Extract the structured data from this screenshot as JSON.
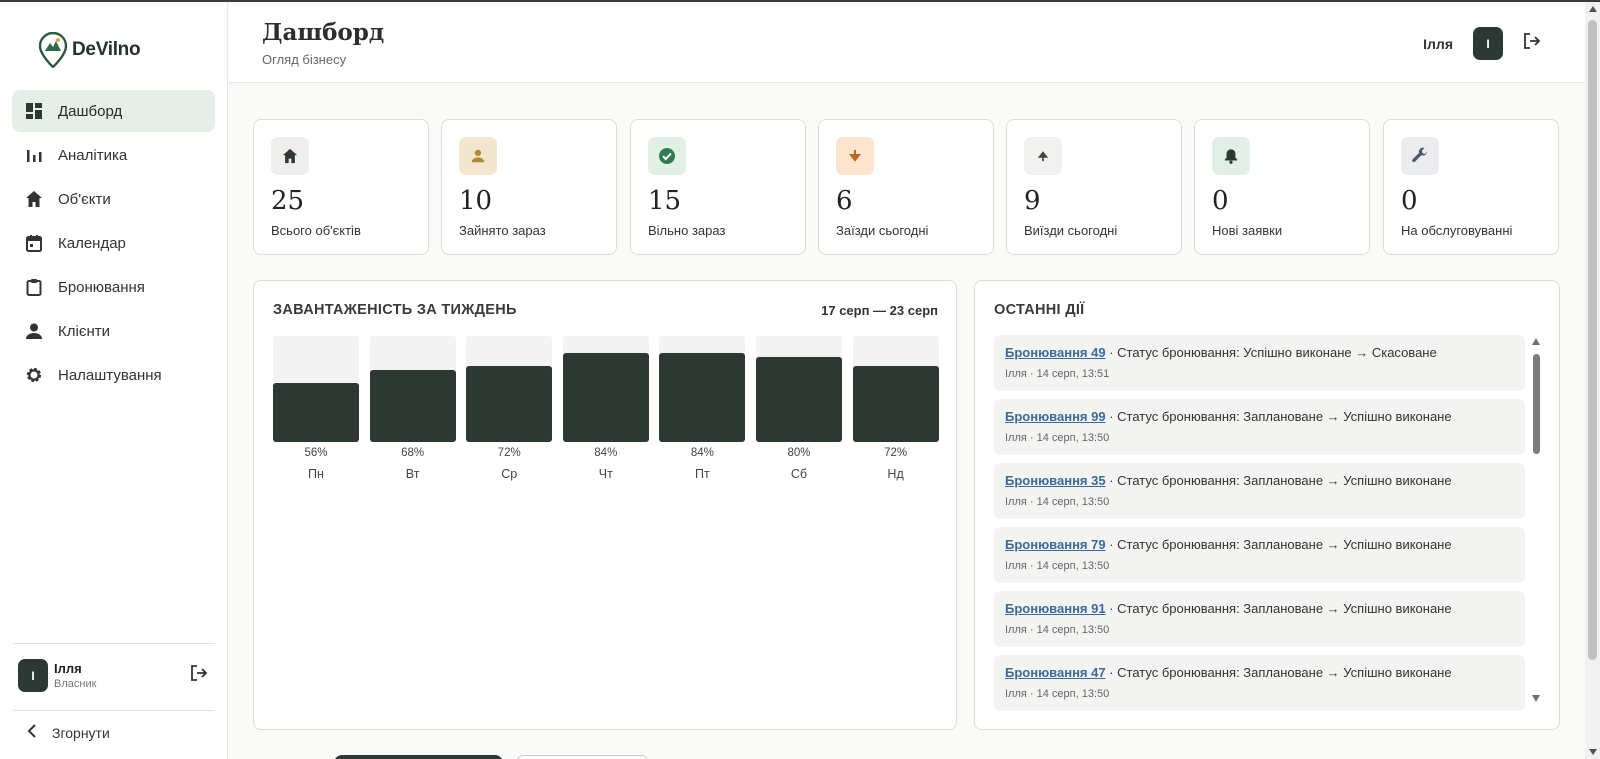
{
  "app": {
    "logo_text": "DeVilno"
  },
  "sidebar": {
    "items": [
      {
        "label": "Дашборд",
        "icon": "dashboard-icon",
        "active": true
      },
      {
        "label": "Аналітика",
        "icon": "analytics-icon",
        "active": false
      },
      {
        "label": "Об'єкти",
        "icon": "home-icon",
        "active": false
      },
      {
        "label": "Календар",
        "icon": "calendar-icon",
        "active": false
      },
      {
        "label": "Бронювання",
        "icon": "clipboard-icon",
        "active": false
      },
      {
        "label": "Клієнти",
        "icon": "person-icon",
        "active": false
      },
      {
        "label": "Налаштування",
        "icon": "gear-icon",
        "active": false
      }
    ],
    "user": {
      "initial": "І",
      "name": "Ілля",
      "role": "Власник"
    },
    "collapse_label": "Згорнути"
  },
  "header": {
    "title": "Дашборд",
    "subtitle": "Огляд бізнесу",
    "user_name": "Ілля",
    "user_initial": "І"
  },
  "stats": [
    {
      "value": "25",
      "label": "Всього об'єктів",
      "icon": "home-icon",
      "color": "#2b3833",
      "bg": "#eeeeed"
    },
    {
      "value": "10",
      "label": "Зайнято зараз",
      "icon": "person-icon",
      "color": "#b08a2e",
      "bg": "#f3e6cf"
    },
    {
      "value": "15",
      "label": "Вільно зараз",
      "icon": "check-circle-icon",
      "color": "#2e7d4f",
      "bg": "#e2f0e6"
    },
    {
      "value": "6",
      "label": "Заїзди сьогодні",
      "icon": "arrow-down-icon",
      "color": "#c0661b",
      "bg": "#fbe5cf"
    },
    {
      "value": "9",
      "label": "Виїзди сьогодні",
      "icon": "arrow-up-icon",
      "color": "#444444",
      "bg": "#f1f1f0"
    },
    {
      "value": "0",
      "label": "Нові заявки",
      "icon": "bell-icon",
      "color": "#2b3833",
      "bg": "#e2efe6"
    },
    {
      "value": "0",
      "label": "На обслуговуванні",
      "icon": "wrench-icon",
      "color": "#4a5a6a",
      "bg": "#eaecef"
    }
  ],
  "occupancy": {
    "title": "ЗАВАНТАЖЕНІСТЬ ЗА ТИЖДЕНЬ",
    "range": "17 серп — 23 серп"
  },
  "chart_data": {
    "type": "bar",
    "categories": [
      "Пн",
      "Вт",
      "Ср",
      "Чт",
      "Пт",
      "Сб",
      "Нд"
    ],
    "values": [
      56,
      68,
      72,
      84,
      84,
      80,
      72
    ],
    "value_labels": [
      "56%",
      "68%",
      "72%",
      "84%",
      "84%",
      "80%",
      "72%"
    ],
    "title": "ЗАВАНТАЖЕНІСТЬ ЗА ТИЖДЕНЬ",
    "ylim": [
      0,
      100
    ],
    "color": "#2d3833"
  },
  "activity": {
    "title": "ОСТАННІ ДІЇ",
    "items": [
      {
        "link": "Бронювання 49",
        "text": " · Статус бронювання: Успішно виконане → Скасоване",
        "meta": "Ілля · 14 серп, 13:51"
      },
      {
        "link": "Бронювання 99",
        "text": " · Статус бронювання: Заплановане → Успішно виконане",
        "meta": "Ілля · 14 серп, 13:50"
      },
      {
        "link": "Бронювання 35",
        "text": " · Статус бронювання: Заплановане → Успішно виконане",
        "meta": "Ілля · 14 серп, 13:50"
      },
      {
        "link": "Бронювання 79",
        "text": " · Статус бронювання: Заплановане → Успішно виконане",
        "meta": "Ілля · 14 серп, 13:50"
      },
      {
        "link": "Бронювання 91",
        "text": " · Статус бронювання: Заплановане → Успішно виконане",
        "meta": "Ілля · 14 серп, 13:50"
      },
      {
        "link": "Бронювання 47",
        "text": " · Статус бронювання: Заплановане → Успішно виконане",
        "meta": "Ілля · 14 серп, 13:50"
      }
    ]
  }
}
